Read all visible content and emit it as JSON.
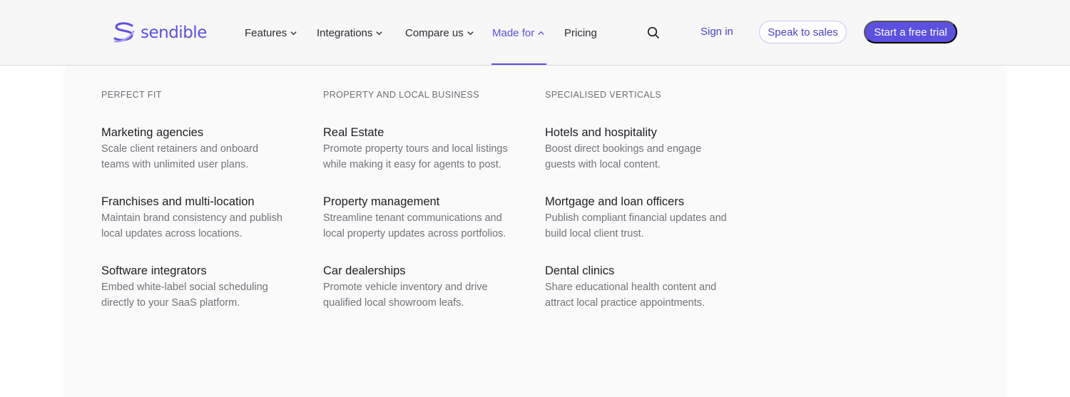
{
  "brand": {
    "name": "sendible",
    "accent": "#5b50e0"
  },
  "nav": {
    "features": "Features",
    "integrations": "Integrations",
    "compare": "Compare us",
    "made_for": "Made for",
    "pricing": "Pricing"
  },
  "actions": {
    "sign_in": "Sign in",
    "speak_to_sales": "Speak to sales",
    "free_trial": "Start a free trial"
  },
  "dropdown": {
    "columns": [
      {
        "heading": "PERFECT FIT",
        "items": [
          {
            "title": "Marketing agencies",
            "desc": "Scale client retainers and onboard teams with unlimited user plans."
          },
          {
            "title": "Franchises and multi-location",
            "desc": "Maintain brand consistency and publish local updates across locations."
          },
          {
            "title": "Software integrators",
            "desc": "Embed white-label social scheduling directly to your SaaS platform."
          }
        ]
      },
      {
        "heading": "PROPERTY AND LOCAL BUSINESS",
        "items": [
          {
            "title": "Real Estate",
            "desc": "Promote property tours and local listings while making it easy for agents to post."
          },
          {
            "title": "Property management",
            "desc": "Streamline tenant communications and local property updates across portfolios."
          },
          {
            "title": "Car dealerships",
            "desc": "Promote vehicle inventory and drive qualified local showroom leafs."
          }
        ]
      },
      {
        "heading": "SPECIALISED VERTICALS",
        "items": [
          {
            "title": "Hotels and hospitality",
            "desc": "Boost direct bookings and engage guests with local content."
          },
          {
            "title": "Mortgage and loan officers",
            "desc": "Publish compliant financial updates and build local client trust."
          },
          {
            "title": "Dental clinics",
            "desc": "Share educational health content and attract local practice appointments."
          }
        ]
      }
    ]
  }
}
